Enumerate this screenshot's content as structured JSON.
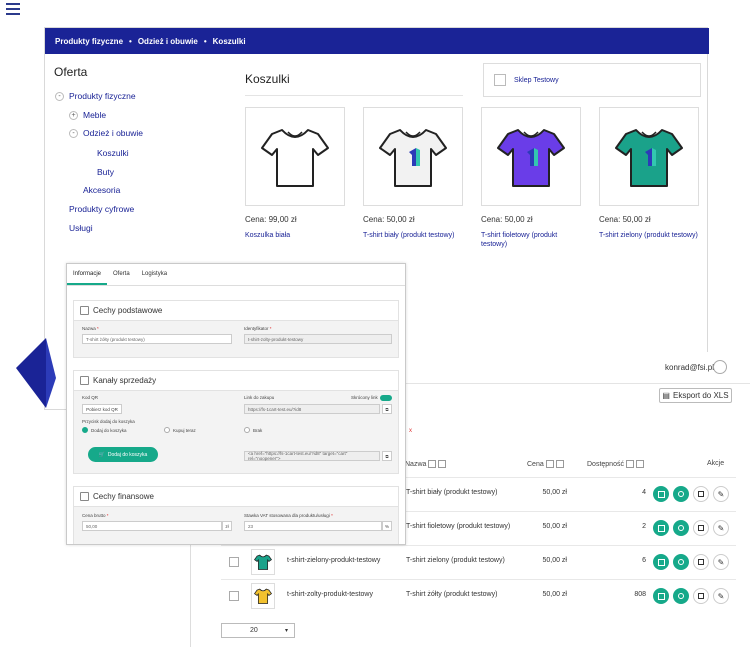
{
  "breadcrumb": [
    "Produkty fizyczne",
    "Odzież i obuwie",
    "Koszulki"
  ],
  "sidebar": {
    "title": "Oferta",
    "items": [
      {
        "label": "Produkty fizyczne",
        "toggle": "-"
      },
      {
        "label": "Meble",
        "toggle": "+"
      },
      {
        "label": "Odzież i obuwie",
        "toggle": "-"
      },
      {
        "label": "Koszulki"
      },
      {
        "label": "Buty"
      },
      {
        "label": "Akcesoria"
      },
      {
        "label": "Produkty cyfrowe"
      },
      {
        "label": "Usługi"
      }
    ]
  },
  "category": {
    "title": "Koszulki"
  },
  "store": {
    "name": "Sklep Testowy"
  },
  "products": [
    {
      "price": "Cena: 99,00 zł",
      "name": "Koszulka biała",
      "color": "#ffffff",
      "logo": false
    },
    {
      "price": "Cena: 50,00 zł",
      "name": "T-shirt biały (produkt testowy)",
      "color": "#f2f2f2",
      "logo": true
    },
    {
      "price": "Cena: 50,00 zł",
      "name": "T-shirt fioletowy (produkt testowy)",
      "color": "#6a3de8",
      "logo": true
    },
    {
      "price": "Cena: 50,00 zł",
      "name": "T-shirt zielony (produkt testowy)",
      "color": "#1aa28a",
      "logo": true
    }
  ],
  "list": {
    "user_email": "konrad@fsi.pl",
    "export_label": "Eksport do XLS",
    "x_mark": "x",
    "columns": {
      "name": "Nazwa",
      "price": "Cena",
      "stock": "Dostępność",
      "actions": "Akcje"
    },
    "rows": [
      {
        "slug": "",
        "name": "T-shirt biały (produkt testowy)",
        "price": "50,00 zł",
        "stock": "4"
      },
      {
        "slug": "",
        "name": "T-shirt fioletowy (produkt testowy)",
        "price": "50,00 zł",
        "stock": "2"
      },
      {
        "slug": "t-shirt-zielony-produkt-testowy",
        "name": "T-shirt zielony (produkt testowy)",
        "price": "50,00 zł",
        "stock": "6",
        "color": "#1aa28a"
      },
      {
        "slug": "t-shirt-zolty-produkt-testowy",
        "name": "T-shirt żółty (produkt testowy)",
        "price": "50,00 zł",
        "stock": "808",
        "color": "#f2c12e"
      }
    ],
    "page_size": "20"
  },
  "form": {
    "tabs": [
      "Informacje",
      "Oferta",
      "Logistyka"
    ],
    "basic": {
      "title": "Cechy podstawowe",
      "name_label": "Nazwa",
      "name_value": "T-shirt żółty (produkt testowy)",
      "id_label": "Identyfikator",
      "id_value": "t-shirt-zolty-produkt-testowy"
    },
    "sales": {
      "title": "Kanały sprzedaży",
      "qr_label": "Kod QR",
      "qr_button": "Pobierz kod QR",
      "link_label": "Link do zakupu",
      "link_value": "https://fs-1cart-test.eu/?id8",
      "short_link_label": "Skrócony link",
      "button_action_label": "Przycisk dodaj do koszyka",
      "radio_options": [
        "Dodaj do koszyka",
        "Kupuj teraz",
        "Brak"
      ],
      "add_to_cart_label": "Dodaj do koszyka",
      "embed_code": "<a href=\"https://fs-1cart-test.eu/?id8\" target=\"cart\" rel=\"noopener\">"
    },
    "finance": {
      "title": "Cechy finansowe",
      "gross_label": "Cena brutto",
      "gross_value": "50,00",
      "vat_label": "Stawka VAT stosowana dla produktu/usługi",
      "vat_value": "23",
      "currency": "zł",
      "percent": "%"
    }
  },
  "colors": {
    "navy": "#1a2396",
    "accent": "#16a98a"
  }
}
